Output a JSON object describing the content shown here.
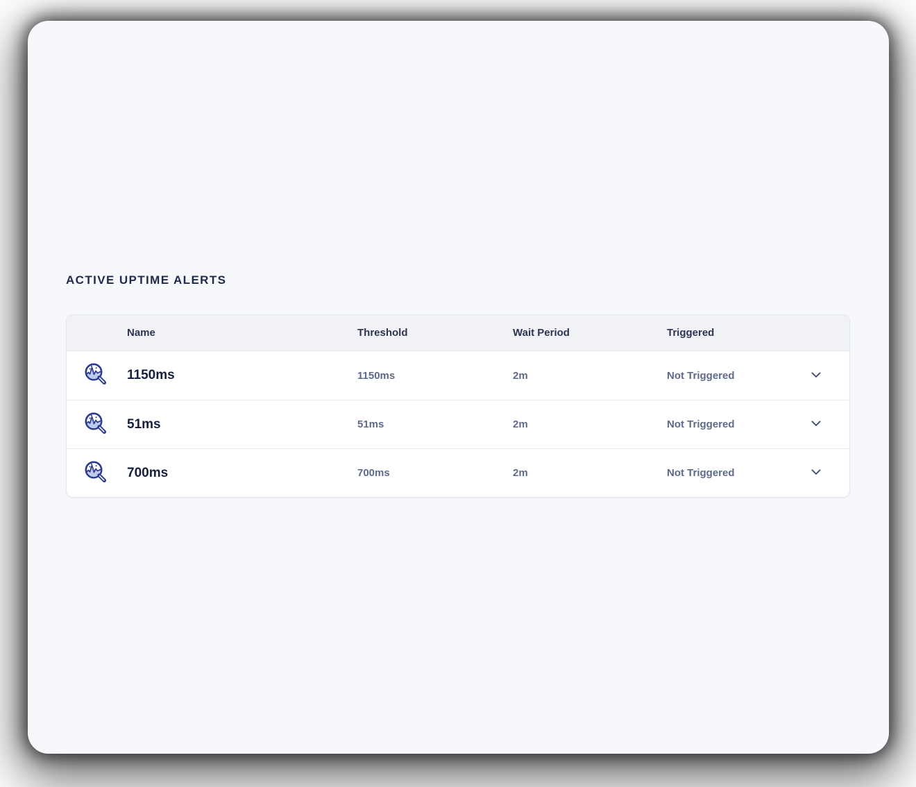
{
  "page": {
    "heading": "ACTIVE UPTIME ALERTS"
  },
  "table": {
    "columns": {
      "name": "Name",
      "threshold": "Threshold",
      "wait_period": "Wait Period",
      "triggered": "Triggered"
    },
    "rows": [
      {
        "name": "1150ms",
        "threshold": "1150ms",
        "wait_period": "2m",
        "triggered": "Not Triggered"
      },
      {
        "name": "51ms",
        "threshold": "51ms",
        "wait_period": "2m",
        "triggered": "Not Triggered"
      },
      {
        "name": "700ms",
        "threshold": "700ms",
        "wait_period": "2m",
        "triggered": "Not Triggered"
      }
    ]
  },
  "icons": {
    "row_icon": "uptime-monitor-magnifier-icon",
    "expand_icon": "chevron-down-icon"
  },
  "colors": {
    "window_background": "#f7f8fb",
    "card_background": "#ffffff",
    "card_header_background": "#f1f2f6",
    "card_border": "#e3e6ed",
    "heading_text": "#1c2a4d",
    "name_text": "#15203f",
    "muted_text": "#5d6a89",
    "icon_navy": "#2b3b8c",
    "icon_fill_light": "#bdc9ef",
    "chevron": "#44526f"
  }
}
